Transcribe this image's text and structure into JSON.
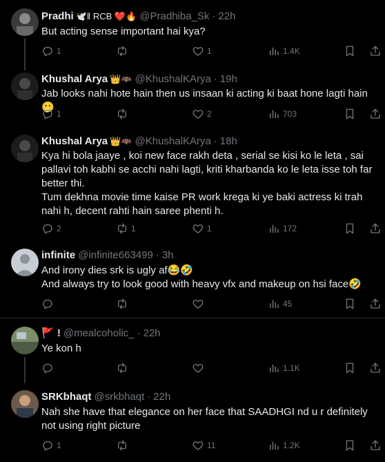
{
  "tweets": [
    {
      "name": "Pradhi",
      "name_extra": "🕊️‖ RCB ❤️🔥",
      "handle": "@Pradhiba_Sk",
      "time": "22h",
      "text": [
        "But acting sense important hai kya?"
      ],
      "replies": "1",
      "retweets": "",
      "likes": "1",
      "views": "1.4K"
    },
    {
      "name": "Khushal Arya",
      "name_extra": "👑🦇",
      "handle": "@KhushalKArya",
      "time": "19h",
      "text": [
        "Jab looks nahi hote hain then us insaan ki acting ki baat hone lagti hain🫢"
      ],
      "replies": "1",
      "retweets": "",
      "likes": "2",
      "views": "703"
    },
    {
      "name": "Khushal Arya",
      "name_extra": "👑🦇",
      "handle": "@KhushalKArya",
      "time": "18h",
      "text": [
        "Kya hi bola jaaye , koi new face rakh deta ,  serial se kisi ko le leta , sai pallavi toh kabhi se acchi nahi lagti, kriti kharbanda ko le leta isse toh far better thi.",
        "Tum dekhna movie time kaise PR work krega ki ye baki actress ki trah nahi h,  decent rahti hain saree phenti h."
      ],
      "replies": "2",
      "retweets": "1",
      "likes": "1",
      "views": "172"
    },
    {
      "name": "infinite",
      "name_extra": "",
      "handle": "@infinite663499",
      "time": "3h",
      "text": [
        "And irony  dies  srk is ugly af😂🤣",
        "And always try to look good  with  heavy vfx and makeup on hsi face🤣"
      ],
      "replies": "",
      "retweets": "",
      "likes": "",
      "views": "45"
    },
    {
      "name": "🚩 !",
      "name_extra": "",
      "handle": "@mealcoholic_",
      "time": "22h",
      "text": [
        "Ye kon h"
      ],
      "replies": "",
      "retweets": "",
      "likes": "",
      "views": "1.1K"
    },
    {
      "name": "SRKbhaqt",
      "name_extra": "",
      "handle": "@srkbhaqt",
      "time": "22h",
      "text": [
        "Nah she have that elegance on her face that SAADHGI nd u r definitely not using right picture"
      ],
      "replies": "1",
      "retweets": "",
      "likes": "11",
      "views": "1.2K"
    }
  ],
  "separator": "·",
  "colors": {
    "background": "#000000",
    "text": "#e7e9ea",
    "muted": "#71767b",
    "divider": "#2f3336",
    "thread": "#333639"
  },
  "icons": [
    "reply-icon",
    "retweet-icon",
    "like-icon",
    "views-icon",
    "bookmark-icon",
    "share-icon"
  ]
}
